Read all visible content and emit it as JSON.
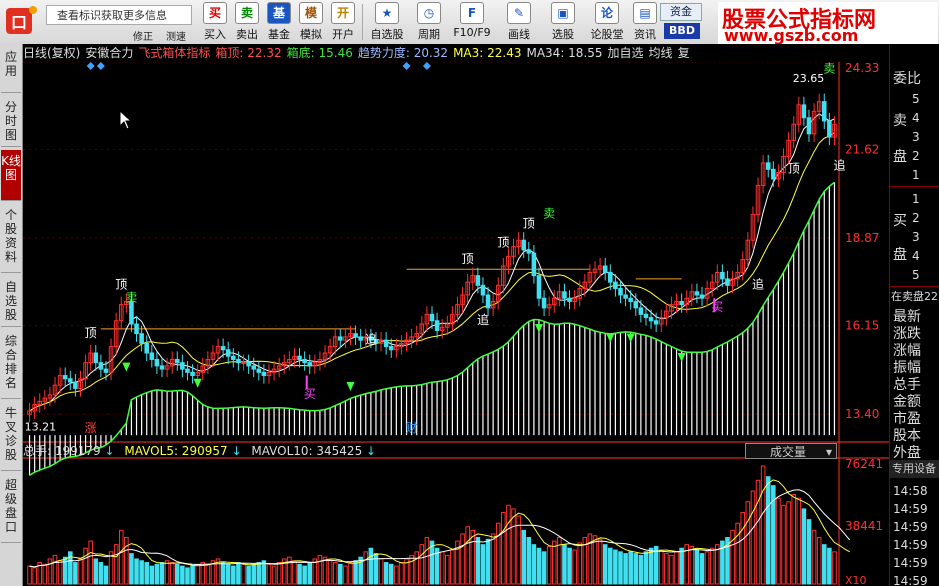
{
  "toolbar": {
    "search_placeholder": "查看标识获取更多信息",
    "sub_labels": [
      "修正",
      "测速"
    ],
    "buttons": [
      {
        "icon": "买",
        "label": "买入"
      },
      {
        "icon": "卖",
        "label": "卖出"
      },
      {
        "icon": "基",
        "label": "基金"
      },
      {
        "icon": "模",
        "label": "模拟"
      },
      {
        "icon": "开",
        "label": "开户"
      },
      {
        "icon": "★",
        "label": "自选股"
      },
      {
        "icon": "◷",
        "label": "周期"
      },
      {
        "icon": "F",
        "label": "F10/F9"
      },
      {
        "icon": "✎",
        "label": "画线"
      },
      {
        "icon": "▣",
        "label": "选股"
      },
      {
        "icon": "论",
        "label": "论股堂"
      },
      {
        "icon": "▤",
        "label": "资讯"
      }
    ],
    "asset_label": "资金",
    "bbd_label": "BBD"
  },
  "watermark": {
    "title": "股票公式指标网",
    "url": "www.gszb.com"
  },
  "sidebar": {
    "tabs": [
      {
        "label": "应用",
        "active": false
      },
      {
        "label": "分时图",
        "active": false
      },
      {
        "label": "K线图",
        "active": true
      },
      {
        "label": "个股资料",
        "active": false
      },
      {
        "label": "自选股",
        "active": false
      },
      {
        "label": "综合排名",
        "active": false
      },
      {
        "label": "牛叉诊股",
        "active": false
      },
      {
        "label": "超级盘口",
        "active": false
      }
    ]
  },
  "info": {
    "period": "日线(复权)",
    "stock": "安徽合力",
    "indicator": "飞式箱体指标",
    "box_top": "箱顶: 22.32",
    "box_bottom": "箱底: 15.46",
    "trend_strength": "趋势力度: 20.32",
    "ma3": "MA3: 22.43",
    "ma34": "MA34: 18.55",
    "add_watch": "加自选",
    "ma_label": "均线",
    "extra": "复"
  },
  "colors": {
    "up": "#ff3030",
    "down": "#40e0f0",
    "box": "#f0a030",
    "buy": "#ff40ff",
    "sell": "#40ff40",
    "label": "#ffffff",
    "axis": "#ff3030",
    "trend": "#40ff40",
    "infobar_white": "#dddddd",
    "infobar_red": "#ff5050",
    "infobar_green": "#40e040",
    "infobar_blue": "#a0b8ff",
    "infobar_yellow": "#ffff40",
    "infobar_magenta": "#ff40ff"
  },
  "price_axis": {
    "labels": [
      "24.33",
      "21.62",
      "18.87",
      "16.15",
      "13.40"
    ],
    "values": [
      24.33,
      21.62,
      18.87,
      16.15,
      13.4
    ]
  },
  "volume_axis": {
    "labels": [
      "76241",
      "38441",
      "X10"
    ]
  },
  "volume_info": {
    "total": "总手: 199179",
    "mavol5": "MAVOL5: 290957",
    "mavol10": "MAVOL10: 345425",
    "dropdown": "成交量"
  },
  "chart_data": {
    "type": "candlestick",
    "price_high_label": "23.65",
    "price_low_label": "13.21",
    "closes": [
      13.5,
      13.7,
      13.8,
      13.9,
      14.0,
      14.3,
      14.6,
      14.5,
      14.4,
      14.2,
      14.5,
      15.0,
      15.3,
      15.0,
      14.8,
      14.7,
      15.5,
      16.3,
      16.8,
      16.9,
      16.2,
      15.9,
      15.6,
      15.3,
      15.1,
      14.9,
      14.8,
      14.9,
      15.1,
      15.0,
      14.8,
      14.7,
      14.6,
      14.7,
      14.9,
      15.1,
      15.3,
      15.5,
      15.4,
      15.2,
      15.1,
      15.0,
      15.0,
      14.9,
      14.8,
      14.7,
      14.6,
      14.7,
      14.8,
      14.9,
      15.0,
      15.1,
      15.2,
      15.1,
      15.0,
      14.9,
      15.0,
      15.1,
      15.3,
      15.5,
      15.8,
      15.7,
      15.8,
      15.9,
      15.8,
      15.7,
      15.8,
      15.7,
      15.6,
      15.7,
      15.5,
      15.4,
      15.5,
      15.6,
      15.7,
      15.8,
      15.9,
      16.2,
      16.5,
      16.3,
      16.0,
      16.1,
      16.2,
      16.5,
      16.8,
      17.1,
      17.5,
      17.7,
      17.4,
      17.1,
      16.7,
      16.9,
      17.4,
      18.0,
      18.3,
      18.6,
      18.8,
      18.5,
      18.4,
      17.7,
      17.0,
      16.7,
      16.8,
      17.0,
      17.2,
      17.0,
      16.9,
      17.0,
      17.3,
      17.5,
      17.8,
      17.9,
      18.0,
      17.8,
      17.5,
      17.3,
      17.1,
      17.0,
      16.9,
      16.7,
      16.5,
      16.4,
      16.3,
      16.2,
      16.4,
      16.6,
      16.8,
      16.9,
      16.8,
      17.0,
      17.2,
      17.1,
      17.0,
      17.3,
      17.5,
      17.8,
      17.6,
      17.4,
      17.6,
      17.8,
      18.2,
      18.8,
      19.6,
      20.5,
      21.2,
      21.0,
      20.7,
      20.9,
      21.4,
      21.9,
      22.4,
      23.0,
      22.6,
      22.1,
      22.8,
      23.1,
      22.5,
      22.0,
      22.4
    ],
    "volumes": [
      10,
      9,
      12,
      11,
      14,
      16,
      13,
      15,
      18,
      12,
      14,
      20,
      24,
      14,
      12,
      10,
      18,
      22,
      30,
      26,
      17,
      14,
      13,
      12,
      10,
      11,
      12,
      13,
      12,
      11,
      10,
      9,
      10,
      11,
      12,
      11,
      13,
      14,
      12,
      11,
      10,
      12,
      11,
      10,
      11,
      12,
      13,
      11,
      10,
      12,
      14,
      15,
      13,
      11,
      10,
      12,
      14,
      16,
      15,
      13,
      12,
      11,
      10,
      12,
      13,
      15,
      18,
      20,
      17,
      14,
      12,
      11,
      10,
      12,
      14,
      16,
      18,
      22,
      26,
      24,
      20,
      18,
      16,
      19,
      24,
      28,
      32,
      30,
      26,
      22,
      25,
      28,
      34,
      40,
      44,
      42,
      38,
      30,
      26,
      22,
      20,
      18,
      21,
      24,
      26,
      22,
      20,
      19,
      23,
      26,
      28,
      27,
      25,
      22,
      20,
      19,
      18,
      17,
      18,
      17,
      16,
      18,
      20,
      21,
      19,
      17,
      16,
      18,
      20,
      22,
      21,
      19,
      17,
      18,
      20,
      22,
      24,
      26,
      30,
      34,
      40,
      46,
      52,
      58,
      66,
      60,
      55,
      48,
      44,
      46,
      50,
      48,
      42,
      36,
      30,
      26,
      22,
      20,
      18,
      22,
      16,
      14
    ]
  },
  "chart_labels": {
    "top": "顶",
    "sell": "卖",
    "buy": "买",
    "chase": "追",
    "rise": "涨",
    "finance": "财"
  },
  "right_panel": {
    "header": "委比",
    "sell_label_a": "卖",
    "sell_label_b": "盘",
    "buy_label_a": "买",
    "buy_label_b": "盘",
    "sell_levels": [
      "5",
      "4",
      "3",
      "2",
      "1"
    ],
    "buy_levels": [
      "1",
      "2",
      "3",
      "4",
      "5"
    ],
    "stats": [
      "在卖盘22",
      "最新",
      "涨跌",
      "涨幅",
      "振幅",
      "总手",
      "金额",
      "市盈",
      "股本",
      "外盘"
    ],
    "device_label": "专用设备",
    "times": [
      "14:58",
      "14:59",
      "14:59",
      "14:59",
      "14:59",
      "14:59"
    ]
  }
}
